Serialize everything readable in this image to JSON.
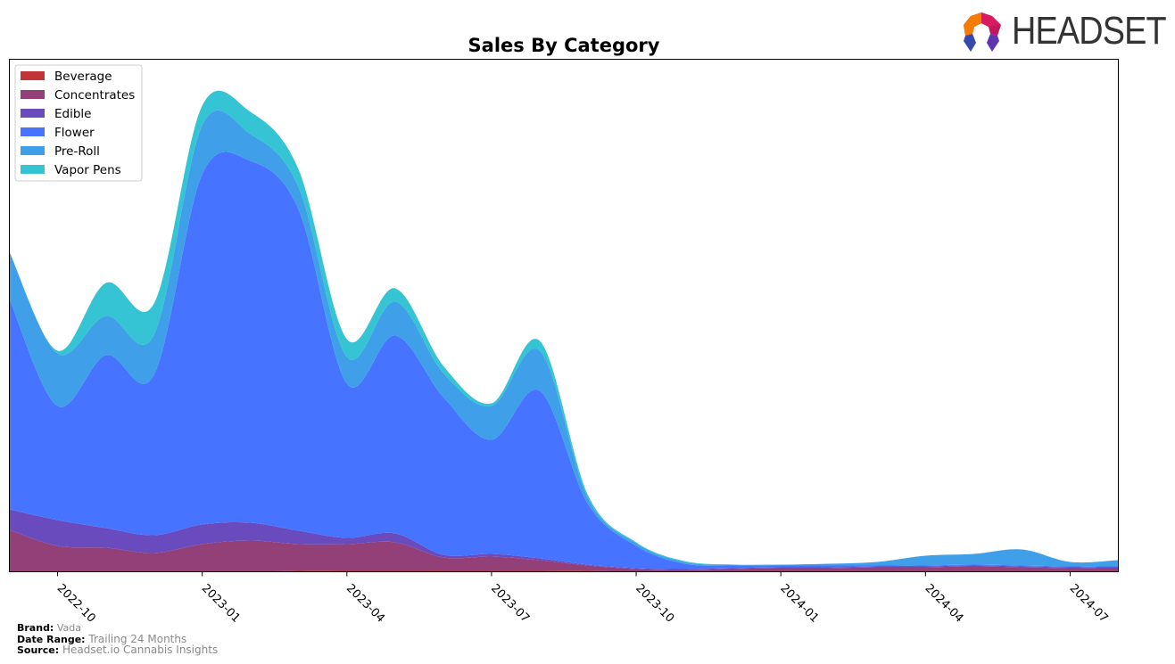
{
  "header": {
    "logo_text": "HEADSET"
  },
  "footer": {
    "brand_label": "Brand:",
    "brand_value": "Vada",
    "date_range_label": "Date Range:",
    "date_range_value": "Trailing 24 Months",
    "source_label": "Source:",
    "source_value": "Headset.io Cannabis Insights"
  },
  "colors": {
    "Beverage": "#c0343a",
    "Concentrates": "#933f78",
    "Edible": "#6a4bbe",
    "Flower": "#4673ff",
    "Pre-Roll": "#3f9fe8",
    "Vapor Pens": "#35c4d3"
  },
  "chart_data": {
    "type": "area",
    "stacked": true,
    "title": "Sales By Category",
    "xlabel": "",
    "ylabel": "",
    "x": [
      "2022-09",
      "2022-10",
      "2022-11",
      "2022-12",
      "2023-01",
      "2023-02",
      "2023-03",
      "2023-04",
      "2023-05",
      "2023-06",
      "2023-07",
      "2023-08",
      "2023-09",
      "2023-10",
      "2023-11",
      "2023-12",
      "2024-01",
      "2024-02",
      "2024-03",
      "2024-04",
      "2024-05",
      "2024-06",
      "2024-07",
      "2024-08"
    ],
    "x_tick_labels": [
      "2022-10",
      "2023-01",
      "2023-04",
      "2023-07",
      "2023-10",
      "2024-01",
      "2024-04",
      "2024-07"
    ],
    "ylim": [
      0,
      575
    ],
    "y_ticks_visible": false,
    "grid": false,
    "legend_position": "top-left",
    "series": [
      {
        "name": "Beverage",
        "values": [
          0,
          0,
          0,
          0,
          0,
          0,
          1,
          1,
          1,
          1,
          1,
          1,
          1,
          0,
          0,
          0,
          0,
          0,
          0,
          0,
          0,
          0,
          0,
          0
        ]
      },
      {
        "name": "Concentrates",
        "values": [
          47,
          29,
          27,
          21,
          31,
          35,
          30,
          30,
          32,
          15,
          16,
          12,
          6,
          3,
          2,
          3,
          4,
          4,
          5,
          5,
          6,
          5,
          4,
          4
        ]
      },
      {
        "name": "Edible",
        "values": [
          23,
          29,
          22,
          20,
          22,
          20,
          15,
          7,
          10,
          3,
          3,
          2,
          1,
          1,
          1,
          1,
          1,
          1,
          1,
          1,
          1,
          1,
          1,
          1
        ]
      },
      {
        "name": "Flower",
        "values": [
          236,
          128,
          194,
          180,
          393,
          406,
          360,
          173,
          222,
          177,
          128,
          188,
          68,
          25,
          6,
          3,
          2,
          2,
          1,
          1,
          1,
          1,
          1,
          1
        ]
      },
      {
        "name": "Pre-Roll",
        "values": [
          53,
          59,
          44,
          45,
          55,
          30,
          25,
          30,
          38,
          27,
          38,
          45,
          7,
          3,
          2,
          1,
          1,
          2,
          4,
          11,
          12,
          18,
          5,
          7
        ]
      },
      {
        "name": "Vapor Pens",
        "values": [
          0,
          3,
          37,
          35,
          22,
          25,
          20,
          20,
          15,
          8,
          3,
          11,
          3,
          1,
          1,
          0,
          0,
          0,
          0,
          0,
          0,
          0,
          0,
          0
        ]
      }
    ]
  }
}
